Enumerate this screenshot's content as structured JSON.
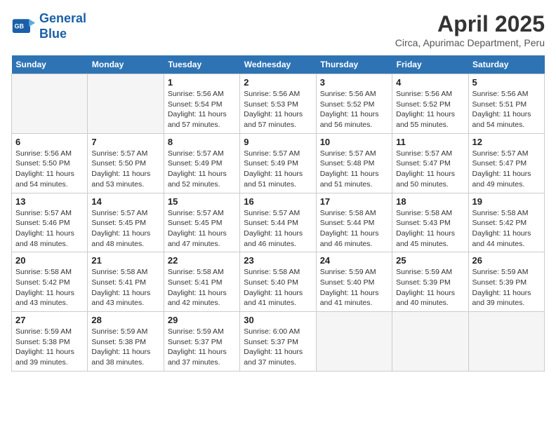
{
  "header": {
    "logo_line1": "General",
    "logo_line2": "Blue",
    "month": "April 2025",
    "location": "Circa, Apurimac Department, Peru"
  },
  "days_of_week": [
    "Sunday",
    "Monday",
    "Tuesday",
    "Wednesday",
    "Thursday",
    "Friday",
    "Saturday"
  ],
  "weeks": [
    [
      {
        "day": "",
        "info": ""
      },
      {
        "day": "",
        "info": ""
      },
      {
        "day": "1",
        "info": "Sunrise: 5:56 AM\nSunset: 5:54 PM\nDaylight: 11 hours and 57 minutes."
      },
      {
        "day": "2",
        "info": "Sunrise: 5:56 AM\nSunset: 5:53 PM\nDaylight: 11 hours and 57 minutes."
      },
      {
        "day": "3",
        "info": "Sunrise: 5:56 AM\nSunset: 5:52 PM\nDaylight: 11 hours and 56 minutes."
      },
      {
        "day": "4",
        "info": "Sunrise: 5:56 AM\nSunset: 5:52 PM\nDaylight: 11 hours and 55 minutes."
      },
      {
        "day": "5",
        "info": "Sunrise: 5:56 AM\nSunset: 5:51 PM\nDaylight: 11 hours and 54 minutes."
      }
    ],
    [
      {
        "day": "6",
        "info": "Sunrise: 5:56 AM\nSunset: 5:50 PM\nDaylight: 11 hours and 54 minutes."
      },
      {
        "day": "7",
        "info": "Sunrise: 5:57 AM\nSunset: 5:50 PM\nDaylight: 11 hours and 53 minutes."
      },
      {
        "day": "8",
        "info": "Sunrise: 5:57 AM\nSunset: 5:49 PM\nDaylight: 11 hours and 52 minutes."
      },
      {
        "day": "9",
        "info": "Sunrise: 5:57 AM\nSunset: 5:49 PM\nDaylight: 11 hours and 51 minutes."
      },
      {
        "day": "10",
        "info": "Sunrise: 5:57 AM\nSunset: 5:48 PM\nDaylight: 11 hours and 51 minutes."
      },
      {
        "day": "11",
        "info": "Sunrise: 5:57 AM\nSunset: 5:47 PM\nDaylight: 11 hours and 50 minutes."
      },
      {
        "day": "12",
        "info": "Sunrise: 5:57 AM\nSunset: 5:47 PM\nDaylight: 11 hours and 49 minutes."
      }
    ],
    [
      {
        "day": "13",
        "info": "Sunrise: 5:57 AM\nSunset: 5:46 PM\nDaylight: 11 hours and 48 minutes."
      },
      {
        "day": "14",
        "info": "Sunrise: 5:57 AM\nSunset: 5:45 PM\nDaylight: 11 hours and 48 minutes."
      },
      {
        "day": "15",
        "info": "Sunrise: 5:57 AM\nSunset: 5:45 PM\nDaylight: 11 hours and 47 minutes."
      },
      {
        "day": "16",
        "info": "Sunrise: 5:57 AM\nSunset: 5:44 PM\nDaylight: 11 hours and 46 minutes."
      },
      {
        "day": "17",
        "info": "Sunrise: 5:58 AM\nSunset: 5:44 PM\nDaylight: 11 hours and 46 minutes."
      },
      {
        "day": "18",
        "info": "Sunrise: 5:58 AM\nSunset: 5:43 PM\nDaylight: 11 hours and 45 minutes."
      },
      {
        "day": "19",
        "info": "Sunrise: 5:58 AM\nSunset: 5:42 PM\nDaylight: 11 hours and 44 minutes."
      }
    ],
    [
      {
        "day": "20",
        "info": "Sunrise: 5:58 AM\nSunset: 5:42 PM\nDaylight: 11 hours and 43 minutes."
      },
      {
        "day": "21",
        "info": "Sunrise: 5:58 AM\nSunset: 5:41 PM\nDaylight: 11 hours and 43 minutes."
      },
      {
        "day": "22",
        "info": "Sunrise: 5:58 AM\nSunset: 5:41 PM\nDaylight: 11 hours and 42 minutes."
      },
      {
        "day": "23",
        "info": "Sunrise: 5:58 AM\nSunset: 5:40 PM\nDaylight: 11 hours and 41 minutes."
      },
      {
        "day": "24",
        "info": "Sunrise: 5:59 AM\nSunset: 5:40 PM\nDaylight: 11 hours and 41 minutes."
      },
      {
        "day": "25",
        "info": "Sunrise: 5:59 AM\nSunset: 5:39 PM\nDaylight: 11 hours and 40 minutes."
      },
      {
        "day": "26",
        "info": "Sunrise: 5:59 AM\nSunset: 5:39 PM\nDaylight: 11 hours and 39 minutes."
      }
    ],
    [
      {
        "day": "27",
        "info": "Sunrise: 5:59 AM\nSunset: 5:38 PM\nDaylight: 11 hours and 39 minutes."
      },
      {
        "day": "28",
        "info": "Sunrise: 5:59 AM\nSunset: 5:38 PM\nDaylight: 11 hours and 38 minutes."
      },
      {
        "day": "29",
        "info": "Sunrise: 5:59 AM\nSunset: 5:37 PM\nDaylight: 11 hours and 37 minutes."
      },
      {
        "day": "30",
        "info": "Sunrise: 6:00 AM\nSunset: 5:37 PM\nDaylight: 11 hours and 37 minutes."
      },
      {
        "day": "",
        "info": ""
      },
      {
        "day": "",
        "info": ""
      },
      {
        "day": "",
        "info": ""
      }
    ]
  ]
}
